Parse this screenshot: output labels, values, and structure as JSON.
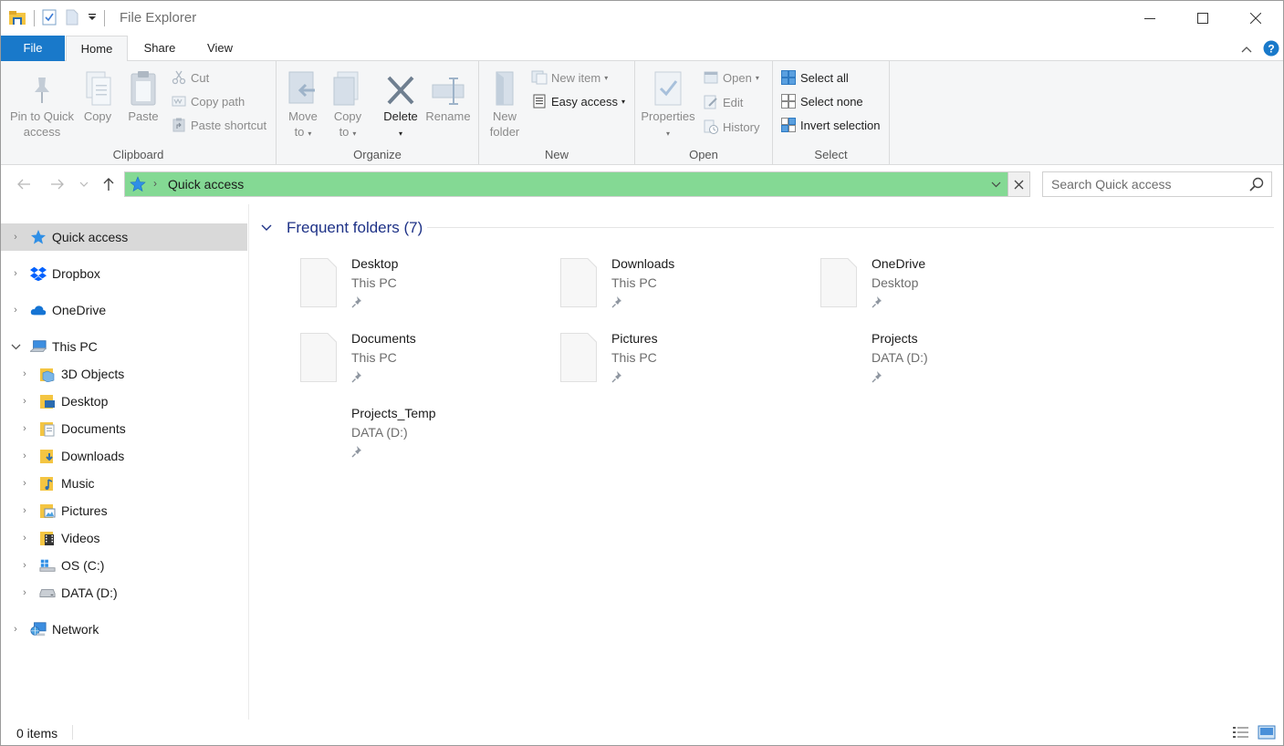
{
  "window": {
    "title": "File Explorer",
    "controls": {
      "minimize": "minimize",
      "maximize": "maximize",
      "close": "close"
    }
  },
  "tabs": {
    "file": "File",
    "home": "Home",
    "share": "Share",
    "view": "View"
  },
  "ribbon": {
    "clipboard": {
      "label": "Clipboard",
      "pin_l1": "Pin to Quick",
      "pin_l2": "access",
      "copy": "Copy",
      "paste": "Paste",
      "cut": "Cut",
      "copy_path": "Copy path",
      "paste_shortcut": "Paste shortcut"
    },
    "organize": {
      "label": "Organize",
      "move_l1": "Move",
      "move_l2": "to",
      "copyto_l1": "Copy",
      "copyto_l2": "to",
      "delete": "Delete",
      "rename": "Rename"
    },
    "new": {
      "label": "New",
      "folder_l1": "New",
      "folder_l2": "folder",
      "new_item": "New item",
      "easy_access": "Easy access"
    },
    "open": {
      "label": "Open",
      "properties": "Properties",
      "open": "Open",
      "edit": "Edit",
      "history": "History"
    },
    "select": {
      "label": "Select",
      "select_all": "Select all",
      "select_none": "Select none",
      "invert": "Invert selection"
    }
  },
  "address": {
    "path": "Quick access",
    "search_placeholder": "Search Quick access"
  },
  "nav": {
    "items": [
      {
        "label": "Quick access"
      },
      {
        "label": "Dropbox"
      },
      {
        "label": "OneDrive"
      },
      {
        "label": "This PC"
      },
      {
        "label": "3D Objects"
      },
      {
        "label": "Desktop"
      },
      {
        "label": "Documents"
      },
      {
        "label": "Downloads"
      },
      {
        "label": "Music"
      },
      {
        "label": "Pictures"
      },
      {
        "label": "Videos"
      },
      {
        "label": "OS (C:)"
      },
      {
        "label": "DATA (D:)"
      },
      {
        "label": "Network"
      }
    ]
  },
  "content": {
    "section_title": "Frequent folders (7)",
    "folders": [
      {
        "name": "Desktop",
        "location": "This PC"
      },
      {
        "name": "Downloads",
        "location": "This PC"
      },
      {
        "name": "OneDrive",
        "location": "Desktop"
      },
      {
        "name": "Documents",
        "location": "This PC"
      },
      {
        "name": "Pictures",
        "location": "This PC"
      },
      {
        "name": "Projects",
        "location": "DATA (D:)"
      },
      {
        "name": "Projects_Temp",
        "location": "DATA (D:)"
      }
    ]
  },
  "status": {
    "items": "0 items"
  },
  "colors": {
    "file_tab": "#1979ca",
    "address_highlight": "#84d994",
    "section_title": "#1e3287",
    "selected_nav": "#d9d9d9"
  }
}
